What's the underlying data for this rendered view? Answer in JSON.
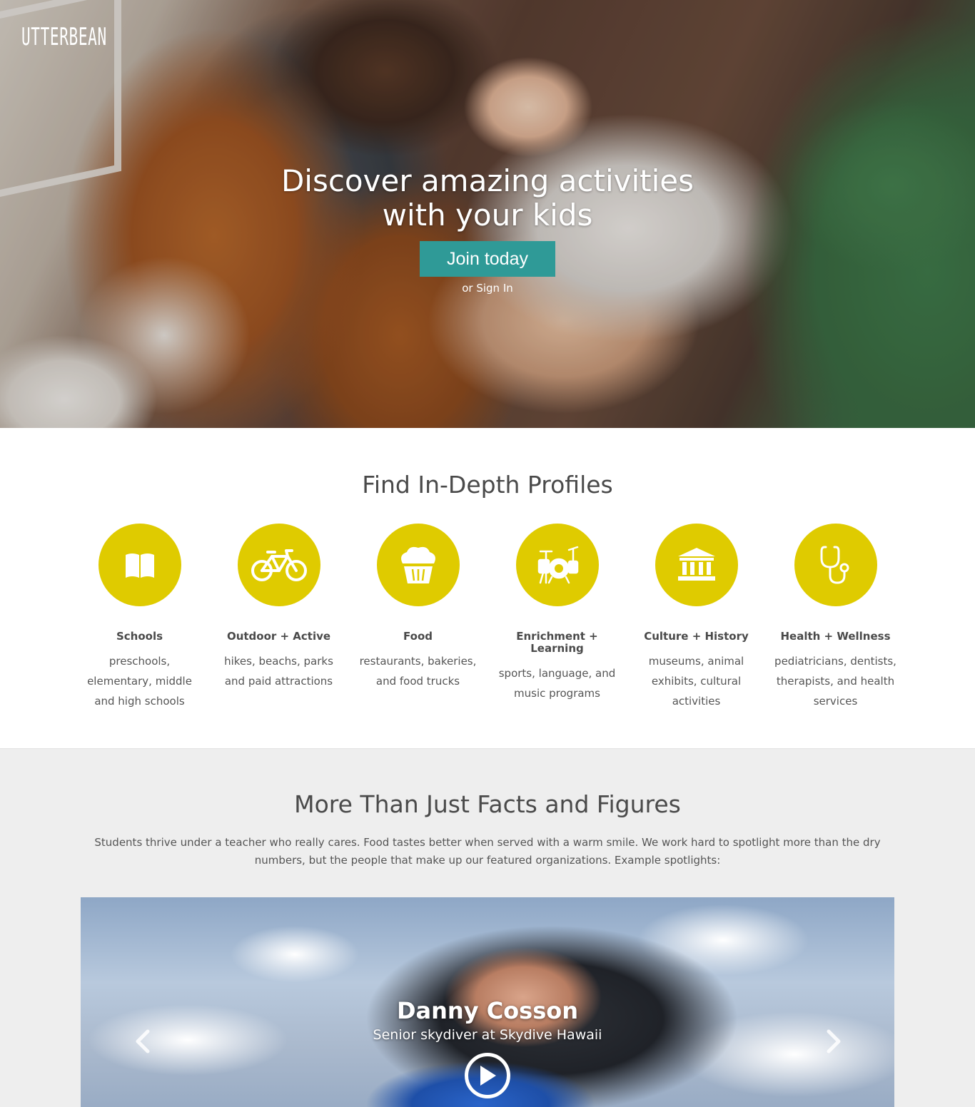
{
  "header": {
    "logo_text": "UTTERBEAN"
  },
  "hero": {
    "title_line1": "Discover amazing activities",
    "title_line2": "with your kids",
    "join_label": "Join today",
    "signin_label": "or Sign In"
  },
  "profiles": {
    "title": "Find In-Depth Profiles",
    "categories": [
      {
        "name": "Schools",
        "description": "preschools, elementary, middle and high schools",
        "icon": "book-icon"
      },
      {
        "name": "Outdoor + Active",
        "description": "hikes, beachs, parks and paid attractions",
        "icon": "bicycle-icon"
      },
      {
        "name": "Food",
        "description": "restaurants, bakeries, and food trucks",
        "icon": "cupcake-icon"
      },
      {
        "name": "Enrichment + Learning",
        "description": "sports, language, and music programs",
        "icon": "drum-kit-icon"
      },
      {
        "name": "Culture + History",
        "description": "museums, animal exhibits, cultural activities",
        "icon": "museum-icon"
      },
      {
        "name": "Health + Wellness",
        "description": "pediatricians, dentists, therapists, and health services",
        "icon": "stethoscope-icon"
      }
    ]
  },
  "facts": {
    "title": "More Than Just Facts and Figures",
    "text": "Students thrive under a teacher who really cares. Food tastes better when served with a warm smile. We work hard to spotlight more than the dry numbers, but the people that make up our featured organizations. Example spotlights:"
  },
  "spotlight": {
    "name": "Danny Cosson",
    "role": "Senior skydiver at Skydive Hawaii"
  },
  "colors": {
    "accent_teal": "#2f9a97",
    "icon_yellow": "#dfcb00",
    "facts_bg": "#eeeeee"
  }
}
